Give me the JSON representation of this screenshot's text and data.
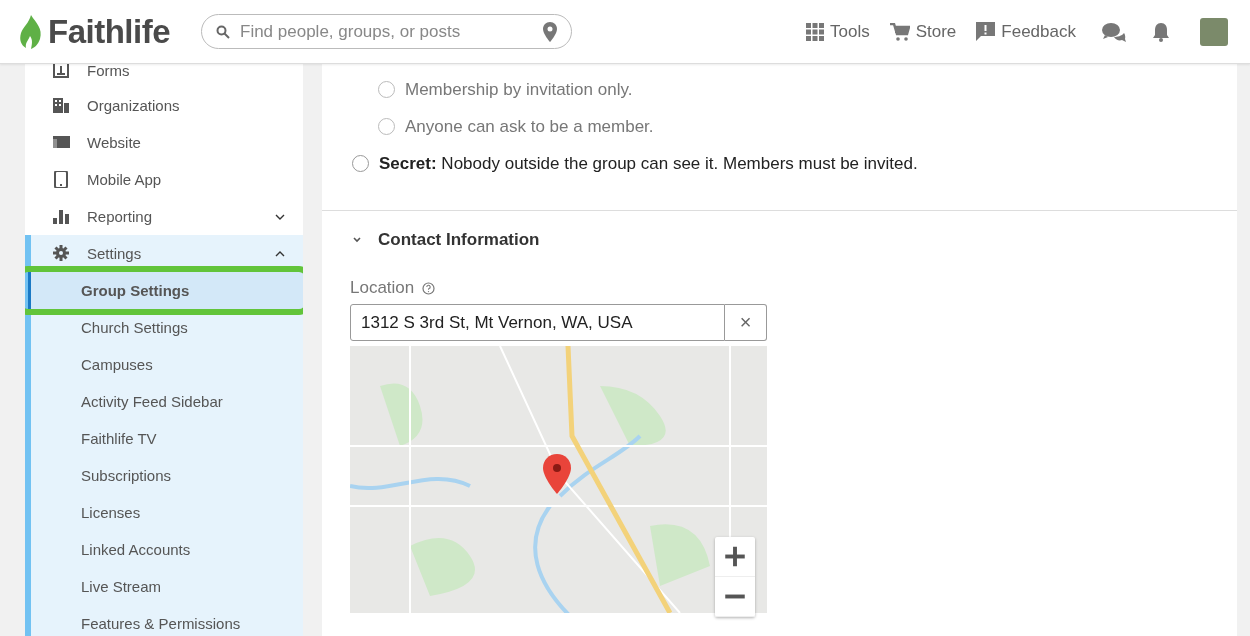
{
  "header": {
    "logo": "Faithlife",
    "search": {
      "placeholder": "Find people, groups, or posts"
    },
    "nav": [
      {
        "label": "Tools"
      },
      {
        "label": "Store"
      },
      {
        "label": "Feedback"
      }
    ]
  },
  "sidebar": {
    "items": [
      {
        "label": "Forms"
      },
      {
        "label": "Organizations"
      },
      {
        "label": "Website"
      },
      {
        "label": "Mobile App"
      },
      {
        "label": "Reporting",
        "expanded": false
      },
      {
        "label": "Settings",
        "expanded": true,
        "children": [
          {
            "label": "Group Settings",
            "selected": true
          },
          {
            "label": "Church Settings",
            "selected": false
          },
          {
            "label": "Campuses",
            "selected": false
          },
          {
            "label": "Activity Feed Sidebar",
            "selected": false
          },
          {
            "label": "Faithlife TV",
            "selected": false
          },
          {
            "label": "Subscriptions",
            "selected": false
          },
          {
            "label": "Licenses",
            "selected": false
          },
          {
            "label": "Linked Accounts",
            "selected": false
          },
          {
            "label": "Live Stream",
            "selected": false
          },
          {
            "label": "Features & Permissions",
            "selected": false
          }
        ]
      }
    ]
  },
  "privacy": {
    "options": [
      {
        "kind": "sub",
        "label": "Membership by invitation only.",
        "selected": false
      },
      {
        "kind": "sub",
        "label": "Anyone can ask to be a member.",
        "selected": false
      },
      {
        "kind": "main",
        "label": "**Secret:** Nobody outside the group can see it. Members must be invited.",
        "selected": false
      }
    ]
  },
  "contact": {
    "title": "Contact Information",
    "expanded": true,
    "location": {
      "label": "Location",
      "value": "1312 S 3rd St, Mt Vernon, WA, USA",
      "clear": "×"
    }
  }
}
